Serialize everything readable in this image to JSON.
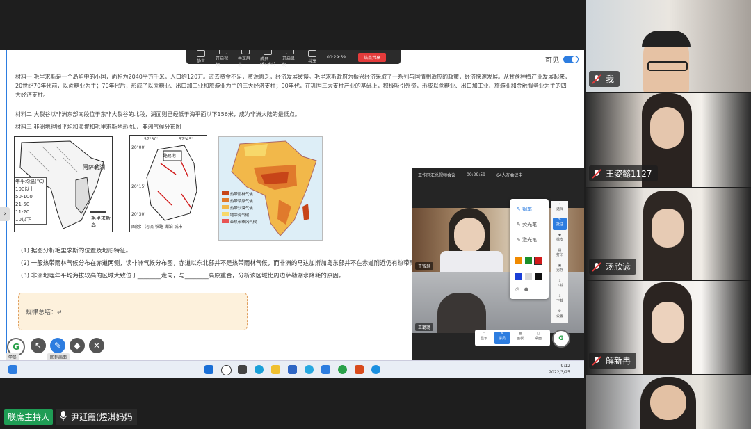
{
  "toolbar": {
    "items": [
      "静音",
      "开启视频",
      "共享屏幕",
      "成员(64/64)",
      "开启录制",
      "共享"
    ],
    "time": "00:29:59",
    "end_label": "结束共享",
    "visible_label": "可见"
  },
  "document": {
    "material1": "材料一  毛里求斯是一个岛屿中的小国，面积为2040平方千米，人口约120万。过去资金不足，资源匮乏，经济发展缓慢。毛里求斯政府为振兴经济采取了一系列与国情相适应的政策，经济快速发展。从甘蔗种植产业发展起来，20世纪70年代前，以蔗糖业为主；70年代后，形成了以蔗糖业、出口加工业和旅游业为主的三大经济支柱；90年代，在巩固三大支柱产业的基础上，积极吸引外资，形成以蔗糖业、出口加工业、旅游业和金融服务业为主的四大经济支柱。",
    "material2": "材料二  大裂谷以非洲东部南段位于东非大裂谷的北段，湖面则已经低于海平面以下156米，成为非洲大陆的最低点。",
    "material3": "材料三  非洲地理图平均和海拔和毛里求斯地形图、、非洲气候分布图",
    "legend_title": "年平均温(℃)",
    "legend_rows": [
      "100以上",
      "50-100",
      "21-50",
      "11-20",
      "10以下"
    ],
    "lake_label": "阿萨勒湖",
    "island_label": "毛里求斯岛",
    "map2_label": "路易港",
    "map2_legend": "图例： 河流  铁路  湖泊  城市",
    "coords": [
      "57°30'",
      "57°45'",
      "20°00'",
      "20°15'",
      "20°30'"
    ],
    "climate_legend": [
      "热带雨林气候",
      "热带草原气候",
      "热带沙漠气候",
      "地中海气候",
      "亚热带季风气候"
    ],
    "q1": "(1)  据图分析毛里求斯的位置及地形特征。",
    "q2": "(2)  一般热带雨林气候分布在赤道两侧，读非洲气候分布图，赤道以东北部并不是热带雨林气候，而非洲的马达加斯加岛东部并不在赤道附近仍有热带雨林气候，分析其原因。",
    "q3": "(3)  非洲地理年平均海拔较高的区域大致位于________走向，与________高原重合，分析该区域比周边萨勒湖水降耗的原因。",
    "summary_label": "规律总结：↵"
  },
  "bottom_tools": [
    "学员",
    "回到画面"
  ],
  "taskbar": {
    "time": "9:12",
    "date": "2022/3/25"
  },
  "meeting_window": {
    "title": "工作区汇总视频会议",
    "time": "00:29:59",
    "count": "64人在会议中",
    "video1_name": "于智慧",
    "video2_name": "王璐璐",
    "pen_menu": [
      "钢笔",
      "荧光笔",
      "激光笔"
    ],
    "colors": [
      "#f08a00",
      "#1a8f2a",
      "#d11a1a",
      "#1a3fd6",
      "#d8d8d8",
      "#111111"
    ],
    "side_panel": [
      "选择",
      "批注",
      "橡皮",
      "打印",
      "另存",
      "下载",
      "下载",
      "设置"
    ],
    "bottom_buttons": [
      "显示",
      "学员",
      "画板",
      "桌面"
    ]
  },
  "gallery": [
    {
      "name": "我"
    },
    {
      "name": "王姿懿1127"
    },
    {
      "name": "汤欣谚"
    },
    {
      "name": "解新冉"
    },
    {
      "name": ""
    }
  ],
  "host_badge": "联席主持人",
  "speaker_name": "尹延霞(煜淇妈妈"
}
